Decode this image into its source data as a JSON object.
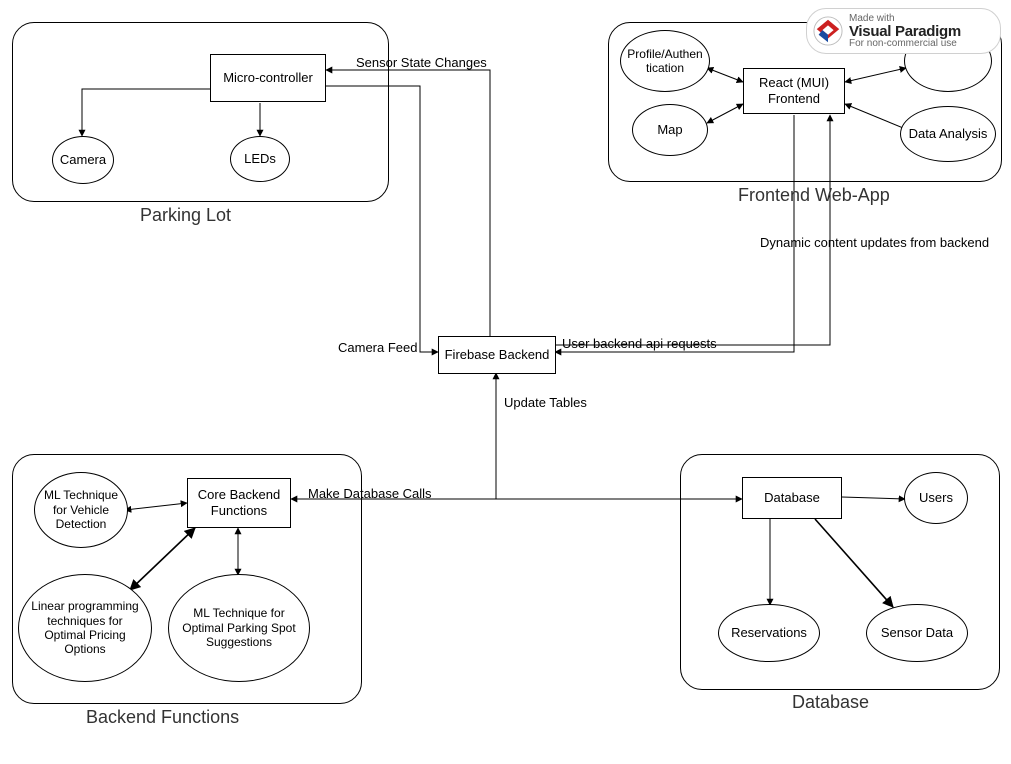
{
  "watermark": {
    "line1": "Made with",
    "title": "Visual Paradigm",
    "line3": "For non-commercial use"
  },
  "groups": {
    "parking_lot": {
      "label": "Parking Lot"
    },
    "frontend": {
      "label": "Frontend Web-App"
    },
    "backend_fn": {
      "label": "Backend Functions"
    },
    "database": {
      "label": "Database"
    }
  },
  "nodes": {
    "microcontroller": "Micro-controller",
    "camera": "Camera",
    "leds": "LEDs",
    "react_frontend": "React (MUI)\nFrontend",
    "profile_auth": "Profile/Authen\ntication",
    "map": "Map",
    "data_analysis": "Data Analysis",
    "firebase": "Firebase Backend",
    "core_backend": "Core Backend\nFunctions",
    "ml_vehicle": "ML Technique\nfor Vehicle\nDetection",
    "linear_prog": "Linear programming\ntechniques for\nOptimal Pricing\nOptions",
    "ml_parking": "ML Technique for\nOptimal Parking Spot\nSuggestions",
    "database_box": "Database",
    "users": "Users",
    "reservations": "Reservations",
    "sensor_data": "Sensor Data"
  },
  "edges": {
    "sensor_state": "Sensor State Changes",
    "camera_feed": "Camera Feed",
    "user_api": "User backend api requests",
    "dynamic": "Dynamic content updates from backend",
    "db_calls": "Make Database Calls",
    "update_tables": "Update Tables"
  }
}
